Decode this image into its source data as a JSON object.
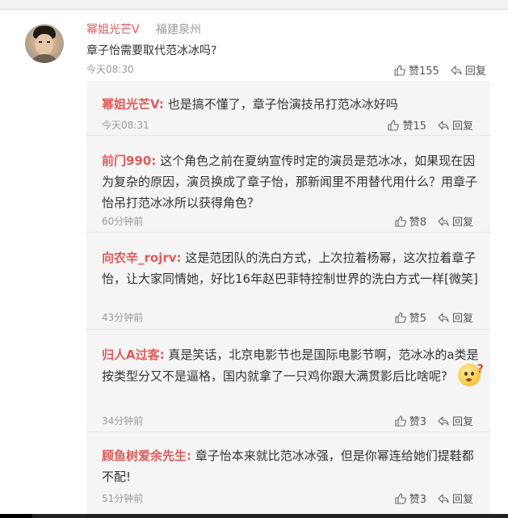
{
  "main_comment": {
    "author": "幂姐光芒V",
    "location": "福建泉州",
    "text": "章子怡需要取代范冰冰吗?",
    "time": "今天08:30",
    "likes": "赞155",
    "reply_label": "回复"
  },
  "replies": [
    {
      "author": "幂姐光芒V:",
      "text": "也是搞不懂了，章子怡演技吊打范冰冰好吗",
      "time": "今天08:31",
      "likes": "赞15",
      "reply_label": "回复"
    },
    {
      "author": "前门990:",
      "text": "这个角色之前在夏纳宣传时定的演员是范冰冰，如果现在因为复杂的原因，演员换成了章子怡，那新闻里不用替代用什么？用章子怡吊打范冰冰所以获得角色？",
      "time": "60分钟前",
      "likes": "赞8",
      "reply_label": "回复"
    },
    {
      "author": "向农辛_rojrv:",
      "text": "这是范团队的洗白方式，上次拉着杨幂，这次拉着章子怡，让大家同情她，好比16年赵巴菲特控制世界的洗白方式一样[微笑]",
      "time": "43分钟前",
      "likes": "赞5",
      "reply_label": "回复"
    },
    {
      "author": "归人A过客:",
      "text": "真是笑话，北京电影节也是国际电影节啊，范冰冰的a类是按类型分又不是逼格，国内就拿了一只鸡你跟大满贯影后比啥呢?",
      "time": "34分钟前",
      "likes": "赞3",
      "reply_label": "回复"
    },
    {
      "author": "顾鱼树爱余先生:",
      "text": "章子怡本来就比范冰冰强，但是你幂连给她们提鞋都不配!",
      "time": "51分钟前",
      "likes": "赞3",
      "reply_label": "回复"
    }
  ],
  "icons": {
    "like": "thumbs-up-icon",
    "reply": "reply-arrow-icon",
    "emoji": "thinking-face-emoji"
  },
  "colors": {
    "author": "#e05a5a",
    "meta": "#9a9a9a",
    "reply_bg": "#f5f5f5"
  }
}
